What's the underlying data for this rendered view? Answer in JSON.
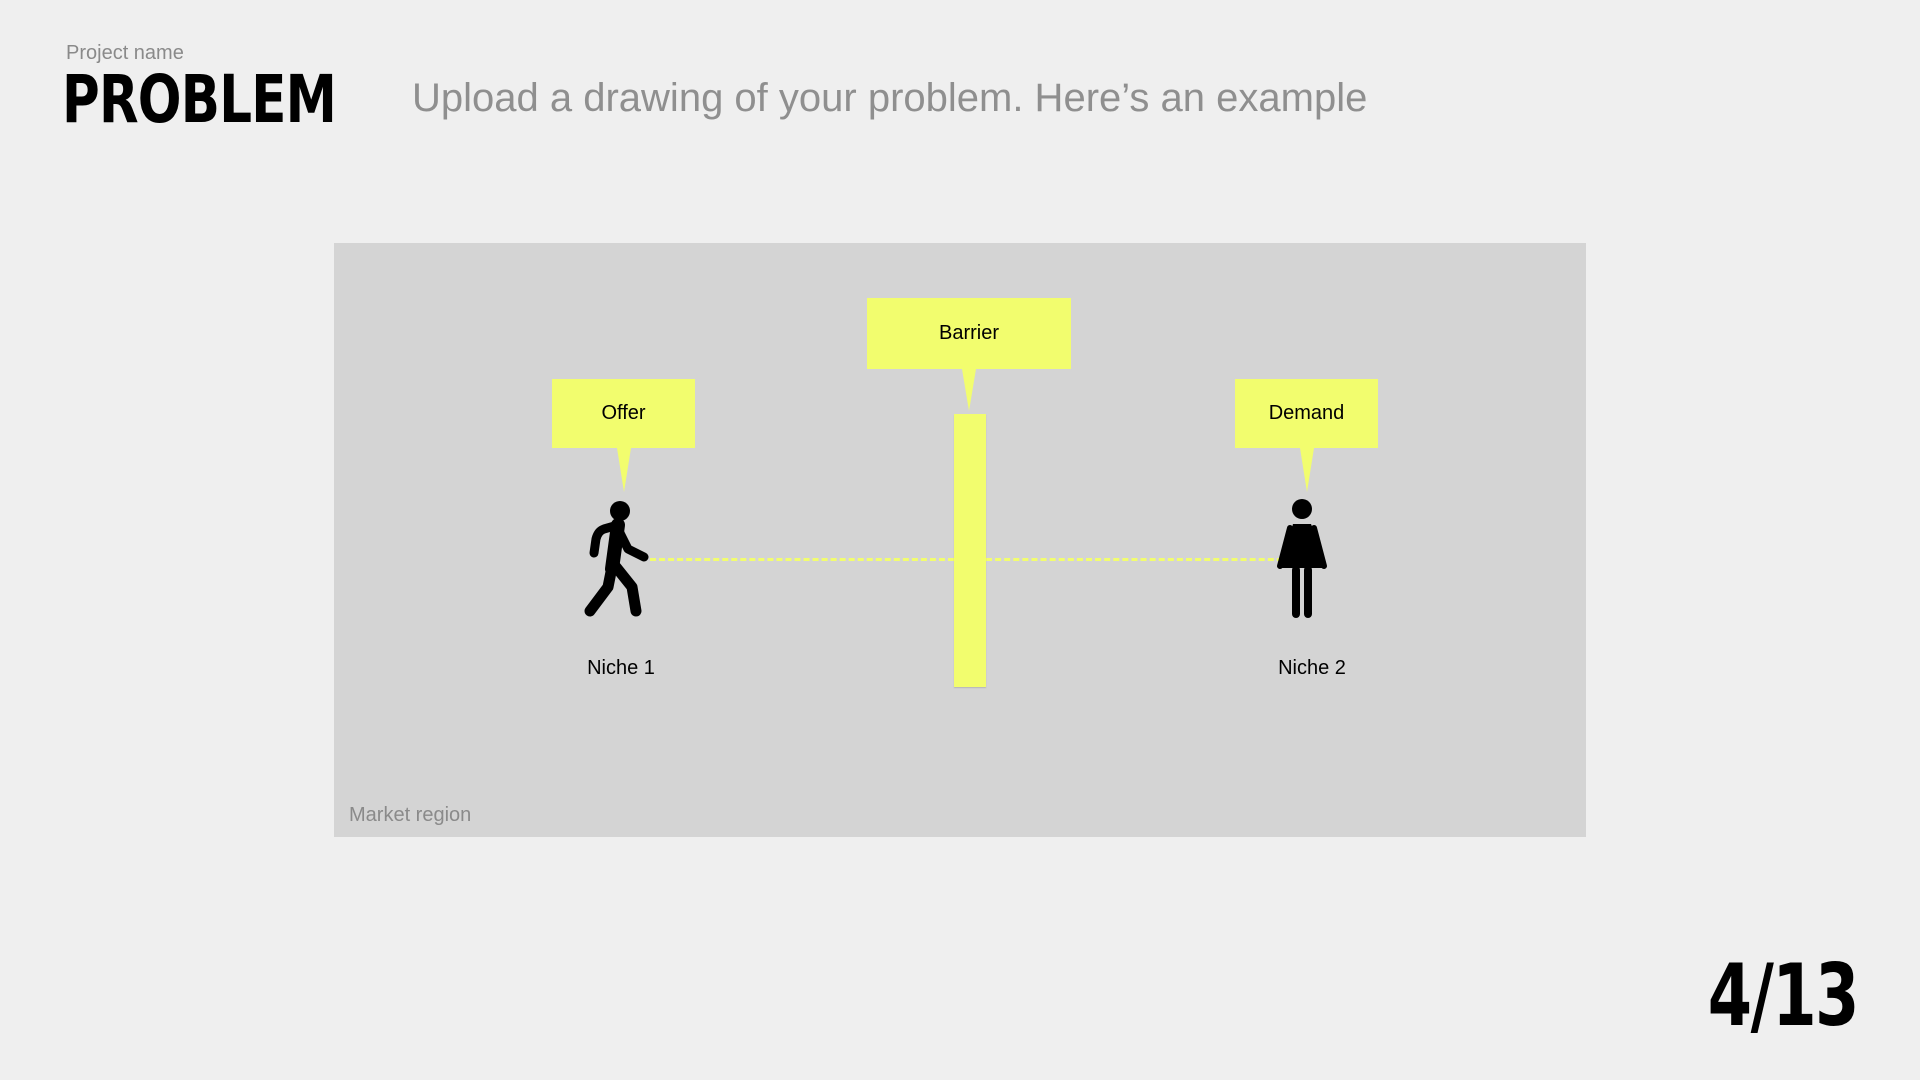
{
  "header": {
    "project_name": "Project name",
    "title": "PROBLEM",
    "subtitle": "Upload a drawing of your problem. Here’s an example"
  },
  "diagram": {
    "region_label": "Market region",
    "callouts": {
      "offer": "Offer",
      "barrier": "Barrier",
      "demand": "Demand"
    },
    "niches": {
      "left": "Niche 1",
      "right": "Niche 2"
    },
    "icons": {
      "left_figure": "walking-person-icon",
      "right_figure": "woman-icon"
    },
    "colors": {
      "highlight": "#f2fd6e",
      "region_background": "#d4d4d4"
    }
  },
  "footer": {
    "page_counter": "4/13"
  }
}
